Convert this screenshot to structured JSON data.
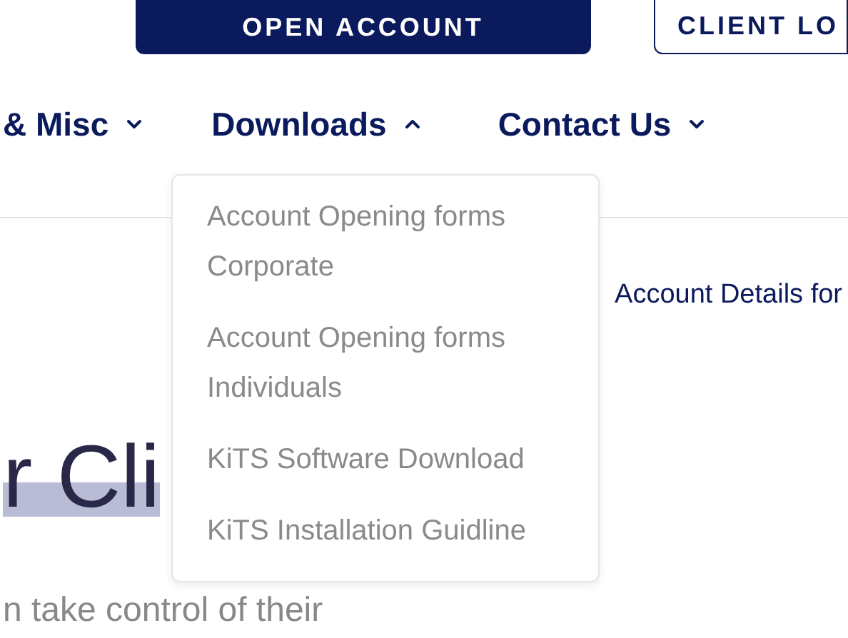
{
  "header_buttons": [
    {
      "label": "OPEN ACCOUNT",
      "kind": "filled"
    },
    {
      "label": "CLIENT LO",
      "kind": "outline"
    }
  ],
  "nav": [
    {
      "label": "& Misc",
      "expanded": false
    },
    {
      "label": "Downloads",
      "expanded": true
    },
    {
      "label": "Contact Us",
      "expanded": false
    }
  ],
  "dropdown": {
    "items": [
      "Account Opening forms Corporate",
      "Account Opening forms Individuals",
      "KiTS Software Download",
      "KiTS Installation Guidline"
    ]
  },
  "content": {
    "link": "Account Details for",
    "heading": "r Cli",
    "subtext": "n take control of their"
  }
}
